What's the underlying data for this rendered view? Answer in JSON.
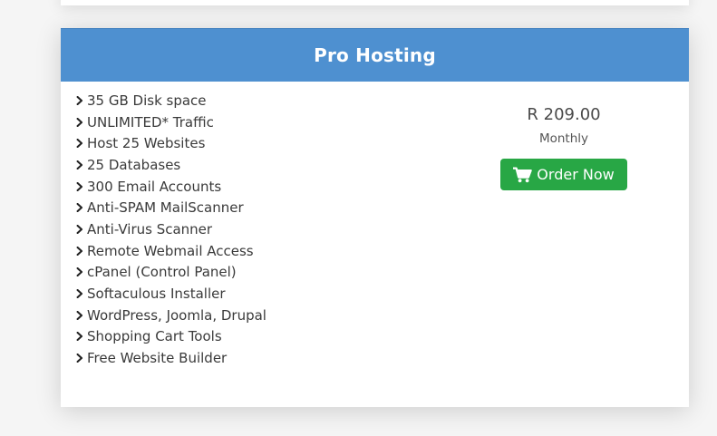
{
  "plan": {
    "title": "Pro Hosting",
    "features": [
      "35 GB Disk space",
      "UNLIMITED* Traffic",
      "Host 25 Websites",
      "25 Databases",
      "300 Email Accounts",
      "Anti-SPAM MailScanner",
      "Anti-Virus Scanner",
      "Remote Webmail Access",
      "cPanel (Control Panel)",
      "Softaculous Installer",
      "WordPress, Joomla, Drupal",
      "Shopping Cart Tools",
      "Free Website Builder"
    ],
    "price": "R 209.00",
    "period": "Monthly",
    "order_label": "Order Now"
  },
  "icons": {
    "feature_bullet": "chevron-right-icon",
    "order_button": "shopping-cart-icon"
  },
  "colors": {
    "header": "#4e90d0",
    "order_button": "#28a745"
  }
}
